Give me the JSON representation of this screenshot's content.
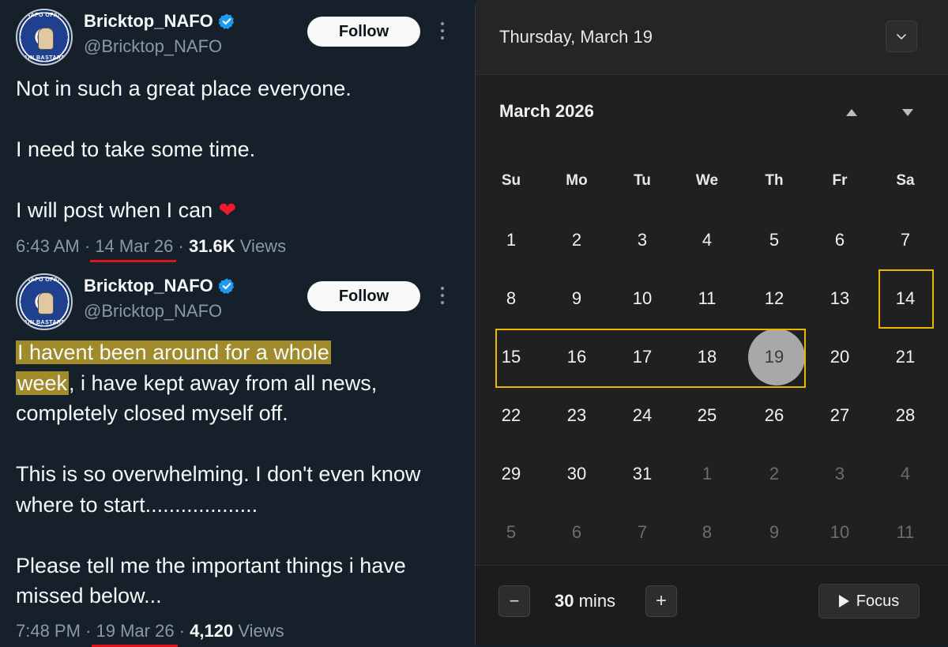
{
  "tweets": [
    {
      "display_name": "Bricktop_NAFO",
      "handle": "@Bricktop_NAFO",
      "follow_label": "Follow",
      "avatar_text_top": "NAFO OFAN",
      "avatar_text_bottom": "MAIN BASTARDS",
      "paragraphs": [
        "Not in such a great place everyone.",
        "I need to take some time.",
        "I will post when I can"
      ],
      "heart": "❤",
      "time": "6:43 AM",
      "sep": "·",
      "date": "14 Mar 26",
      "views_count": "31.6K",
      "views_label": "Views"
    },
    {
      "display_name": "Bricktop_NAFO",
      "handle": "@Bricktop_NAFO",
      "follow_label": "Follow",
      "avatar_text_top": "NAFO OFAN",
      "avatar_text_bottom": "MAIN BASTARDS",
      "highlight_a": "I havent been around for a whole",
      "highlight_b": "week",
      "p1_rest": ", i have kept away from all news, completely closed myself off.",
      "p2": "This is so overwhelming. I don't even know where to start...................",
      "p3": "Please tell me the important things i have missed below...",
      "time": "7:48 PM",
      "sep": "·",
      "date": "19 Mar 26",
      "views_count": "4,120",
      "views_label": "Views"
    }
  ],
  "calendar": {
    "date_title": "Thursday, March 19",
    "month_title": "March 2026",
    "weekdays": [
      "Su",
      "Mo",
      "Tu",
      "We",
      "Th",
      "Fr",
      "Sa"
    ],
    "weeks": [
      [
        "1",
        "2",
        "3",
        "4",
        "5",
        "6",
        "7"
      ],
      [
        "8",
        "9",
        "10",
        "11",
        "12",
        "13",
        "14"
      ],
      [
        "15",
        "16",
        "17",
        "18",
        "19",
        "20",
        "21"
      ],
      [
        "22",
        "23",
        "24",
        "25",
        "26",
        "27",
        "28"
      ],
      [
        "29",
        "30",
        "31",
        "1",
        "2",
        "3",
        "4"
      ],
      [
        "5",
        "6",
        "7",
        "8",
        "9",
        "10",
        "11"
      ]
    ],
    "today": "19",
    "highlight_color": "#e6b800",
    "focus": {
      "minutes_value": "30",
      "minutes_unit": "mins",
      "minus": "−",
      "plus": "+",
      "focus_label": "Focus"
    }
  }
}
